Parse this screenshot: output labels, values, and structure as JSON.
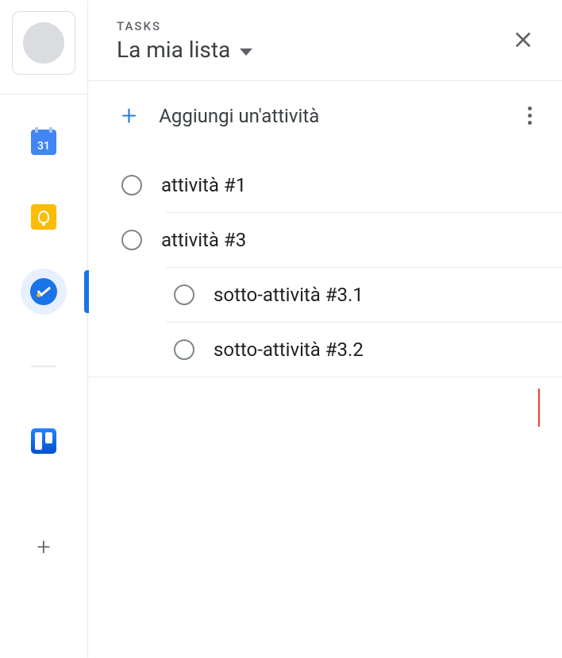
{
  "rail": {
    "calendar_day": "31"
  },
  "header": {
    "label": "TASKS",
    "list_name": "La mia lista"
  },
  "add": {
    "label": "Aggiungi un'attività"
  },
  "tasks": [
    {
      "title": "attività #1",
      "sub": false,
      "sep": true
    },
    {
      "title": "attività #3",
      "sub": false,
      "sep": true
    },
    {
      "title": "sotto-attività #3.1",
      "sub": true,
      "sep": true
    },
    {
      "title": "sotto-attività #3.2",
      "sub": true,
      "sep": false
    }
  ]
}
